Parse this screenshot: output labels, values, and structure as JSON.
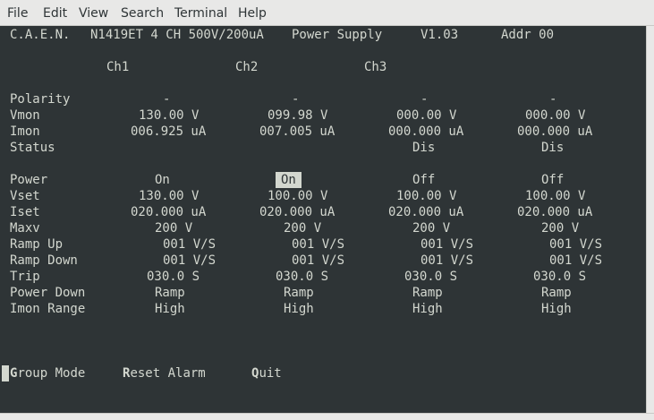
{
  "menubar": {
    "items": [
      "File",
      "Edit",
      "View",
      "Search",
      "Terminal",
      "Help"
    ]
  },
  "header": {
    "model": "C.A.E.N.",
    "device": "N1419ET 4 CH 500V/200uA",
    "product": "Power Supply",
    "version": "V1.03",
    "addr": "Addr 00"
  },
  "channels": [
    "Ch1",
    "Ch2",
    "Ch3"
  ],
  "params": {
    "polarity": {
      "label": "Polarity",
      "values": [
        "-",
        "-",
        "-",
        "-"
      ]
    },
    "vmon": {
      "label": "Vmon",
      "values": [
        "130.00 V",
        "099.98 V",
        "000.00 V",
        "000.00 V"
      ]
    },
    "imon": {
      "label": "Imon",
      "values": [
        "006.925 uA",
        "007.005 uA",
        "000.000 uA",
        "000.000 uA"
      ]
    },
    "status": {
      "label": "Status",
      "values": [
        "",
        "",
        "Dis",
        "Dis"
      ]
    },
    "power": {
      "label": "Power",
      "values": [
        "On",
        "On",
        "Off",
        "Off"
      ]
    },
    "vset": {
      "label": "Vset",
      "values": [
        "130.00 V",
        "100.00 V",
        "100.00 V",
        "100.00 V"
      ]
    },
    "iset": {
      "label": "Iset",
      "values": [
        "020.000 uA",
        "020.000 uA",
        "020.000 uA",
        "020.000 uA"
      ]
    },
    "maxv": {
      "label": "Maxv",
      "values": [
        "200 V",
        "200 V",
        "200 V",
        "200 V"
      ]
    },
    "ramp_up": {
      "label": "Ramp Up",
      "values": [
        "001 V/S",
        "001 V/S",
        "001 V/S",
        "001 V/S"
      ]
    },
    "ramp_down": {
      "label": "Ramp Down",
      "values": [
        "001 V/S",
        "001 V/S",
        "001 V/S",
        "001 V/S"
      ]
    },
    "trip": {
      "label": "Trip",
      "values": [
        "030.0 S",
        "030.0 S",
        "030.0 S",
        "030.0 S"
      ]
    },
    "power_down": {
      "label": "Power Down",
      "values": [
        "Ramp",
        "Ramp",
        "Ramp",
        "Ramp"
      ]
    },
    "imon_range": {
      "label": "Imon Range",
      "values": [
        "High",
        "High",
        "High",
        "High"
      ]
    }
  },
  "footer": {
    "group_mode": {
      "key": "G",
      "rest": "roup Mode"
    },
    "reset_alarm": {
      "key": "R",
      "rest": "eset Alarm"
    },
    "quit": {
      "key": "Q",
      "rest": "uit"
    }
  },
  "colors": {
    "terminal_bg": "#2e3436",
    "terminal_fg": "#d3d7cf",
    "chrome_bg": "#e8e8e7"
  }
}
